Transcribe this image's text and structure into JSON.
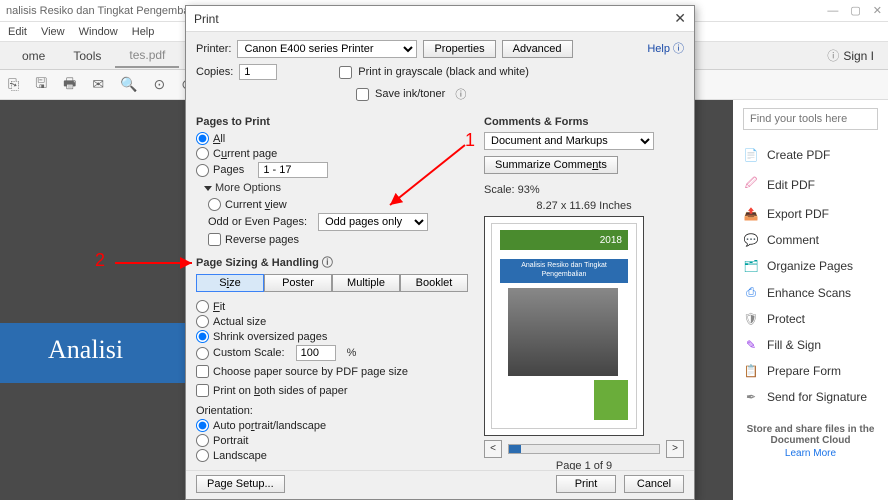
{
  "window": {
    "title": "nalisis Resiko dan Tingkat Pengembalian - Adobe Acrobat Pro DC"
  },
  "menubar": [
    "Edit",
    "View",
    "Window",
    "Help"
  ],
  "tabs": {
    "home": "ome",
    "tools": "Tools",
    "filename": "tes.pdf"
  },
  "signin_label": "Sign I",
  "doc_strip_text": "Analisi",
  "dialog": {
    "title": "Print",
    "help": "Help",
    "printer_label": "Printer:",
    "printer_value": "Canon E400 series Printer",
    "properties_btn": "Properties",
    "advanced_btn": "Advanced",
    "copies_label": "Copies:",
    "copies_value": "1",
    "print_grayscale": "Print in grayscale (black and white)",
    "save_ink": "Save ink/toner",
    "pages_to_print": "Pages to Print",
    "opt_all": "All",
    "opt_current": "Current page",
    "opt_pages": "Pages",
    "pages_range": "1 - 17",
    "more_options": "More Options",
    "opt_current_view": "Current view",
    "odd_even_label": "Odd or Even Pages:",
    "odd_even_value": "Odd pages only",
    "reverse_pages": "Reverse pages",
    "sizing_handling": "Page Sizing & Handling",
    "size_btn": "Size",
    "poster_btn": "Poster",
    "multiple_btn": "Multiple",
    "booklet_btn": "Booklet",
    "fit": "Fit",
    "actual_size": "Actual size",
    "shrink": "Shrink oversized pages",
    "custom_scale": "Custom Scale:",
    "custom_scale_value": "100",
    "custom_scale_pct": "%",
    "choose_paper": "Choose paper source by PDF page size",
    "print_both": "Print on both sides of paper",
    "orientation": "Orientation:",
    "auto_orient": "Auto portrait/landscape",
    "portrait": "Portrait",
    "landscape": "Landscape",
    "comments_forms": "Comments & Forms",
    "comments_value": "Document and Markups",
    "summarize": "Summarize Comments",
    "scale_label": "Scale: 93%",
    "paper_dims": "8.27 x 11.69 Inches",
    "preview_year": "2018",
    "preview_title": "Analisis Resiko dan Tingkat\nPengembalian",
    "page_of": "Page 1 of 9",
    "page_setup": "Page Setup...",
    "print_btn": "Print",
    "cancel_btn": "Cancel"
  },
  "tools_search_placeholder": "Find your tools here",
  "tools": [
    {
      "icon": "📄",
      "cls": "c-red",
      "label": "Create PDF"
    },
    {
      "icon": "🖉",
      "cls": "c-pink",
      "label": "Edit PDF"
    },
    {
      "icon": "📤",
      "cls": "c-green",
      "label": "Export PDF"
    },
    {
      "icon": "💬",
      "cls": "c-orange",
      "label": "Comment"
    },
    {
      "icon": "🗂",
      "cls": "c-teal",
      "label": "Organize Pages"
    },
    {
      "icon": "⎙",
      "cls": "c-blue",
      "label": "Enhance Scans"
    },
    {
      "icon": "🛡",
      "cls": "c-gray",
      "label": "Protect"
    },
    {
      "icon": "✎",
      "cls": "c-purple",
      "label": "Fill & Sign"
    },
    {
      "icon": "📋",
      "cls": "c-darkblue",
      "label": "Prepare Form"
    },
    {
      "icon": "✒",
      "cls": "c-gray",
      "label": "Send for Signature"
    }
  ],
  "promo": {
    "text": "Store and share files in the Document Cloud",
    "link": "Learn More"
  },
  "annotations": {
    "one": "1",
    "two": "2"
  }
}
